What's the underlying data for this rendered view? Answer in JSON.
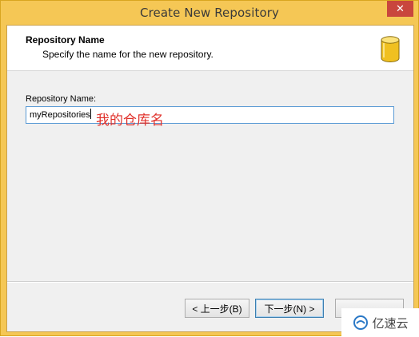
{
  "window": {
    "title": "Create New Repository",
    "close_glyph": "✕"
  },
  "header": {
    "title": "Repository Name",
    "subtitle": "Specify the name for the new repository.",
    "icon": "database-icon"
  },
  "form": {
    "label": "Repository Name:",
    "value": "myRepositories"
  },
  "annotation": {
    "text": "我的仓库名",
    "color": "#e0302a"
  },
  "buttons": {
    "back": "< 上一步(B)",
    "next": "下一步(N) >"
  },
  "watermark": {
    "text": "亿速云"
  },
  "colors": {
    "window_frame": "#f5c755",
    "close_button": "#c9463d",
    "input_border": "#5b9bd5",
    "db_icon": "#f0c020"
  }
}
